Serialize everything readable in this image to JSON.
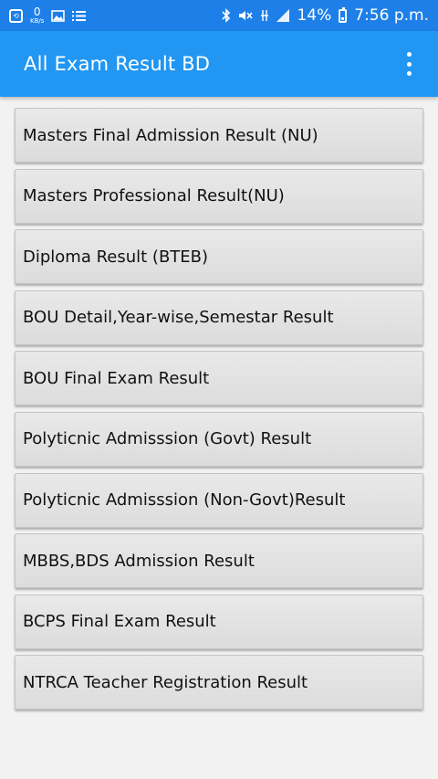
{
  "status_bar": {
    "data_speed": "0",
    "data_unit": "KB/s",
    "battery_percent": "14%",
    "time": "7:56 p.m."
  },
  "app_bar": {
    "title": "All Exam Result BD"
  },
  "menu": [
    "Masters Final Admission Result (NU)",
    "Masters Professional Result(NU)",
    "Diploma Result (BTEB)",
    "BOU Detail,Year-wise,Semestar Result",
    "BOU Final Exam Result",
    "Polyticnic Admisssion (Govt) Result",
    "Polyticnic Admisssion (Non-Govt)Result",
    "MBBS,BDS Admission Result",
    "BCPS Final Exam Result",
    "NTRCA Teacher Registration Result"
  ]
}
